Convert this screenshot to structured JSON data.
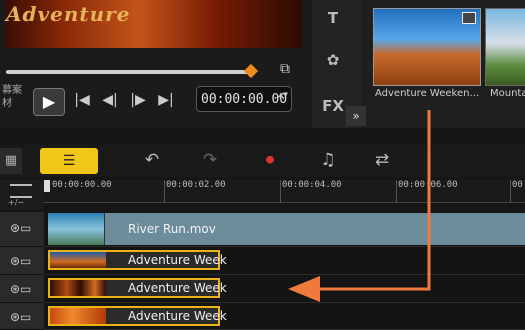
{
  "preview": {
    "video_title": "Adventure",
    "side_text_1": "募案",
    "side_text_2": "材",
    "timecode": "00:00:00.00",
    "timecode_spin": "▲▼",
    "snapshot_icon": "⧉",
    "play_icon": "▶",
    "controls": {
      "home": "|◀",
      "prev": "◀|",
      "next": "|▶",
      "end": "▶|"
    }
  },
  "library": {
    "tools": [
      "T",
      "✿",
      "FX"
    ],
    "expand_icon": "»",
    "thumbnails": [
      {
        "label": "Adventure Weeken…"
      },
      {
        "label": "Mounta"
      }
    ]
  },
  "timeline": {
    "storyboard_icon": "▦",
    "timeline_view_icon": "☰",
    "toolbar_icons": [
      "↶",
      "↷",
      "⏺",
      "♫",
      "⇄"
    ],
    "ruler_left_label": "+/−",
    "ruler_labels": [
      "00:00:00.00",
      "00:00:02.00",
      "00:00:04.00",
      "00:00:06.00",
      "00:0"
    ],
    "tracks": [
      {
        "label": "River Run.mov"
      },
      {
        "label": "Adventure Week"
      },
      {
        "label": "Adventure Week"
      },
      {
        "label": "Adventure Week"
      }
    ]
  },
  "colors": {
    "accent": "#f0c619",
    "clip_border": "#e8b419",
    "arrow": "#f07a3c",
    "video_clip": "#6d8c9a"
  }
}
